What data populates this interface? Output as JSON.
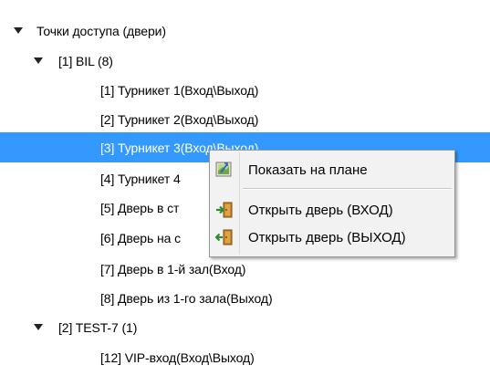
{
  "tree": {
    "root": {
      "label": "Точки доступа (двери)",
      "expanded": true
    },
    "groups": [
      {
        "label": "[1] BIL (8)",
        "expanded": true,
        "items": [
          "[1] Турникет 1(Вход\\Выход)",
          "[2] Турникет 2(Вход\\Выход)",
          "[3] Турникет 3(Вход\\Выход)",
          "[4] Турникет 4",
          "[5] Дверь в ст",
          "[6] Дверь на с",
          "[7] Дверь в 1-й зал(Вход)",
          "[8] Дверь из 1-го зала(Выход)"
        ]
      },
      {
        "label": "[2] TEST-7 (1)",
        "expanded": true,
        "items": [
          "[12] VIP-вход(Вход\\Выход)"
        ]
      }
    ],
    "selected_item": "[3] Турникет 3(Вход\\Выход)"
  },
  "context_menu": {
    "items": [
      {
        "label": "Показать на плане",
        "icon": "map-plan-icon"
      },
      {
        "label": "Открыть дверь (ВХОД)",
        "icon": "door-enter-icon"
      },
      {
        "label": "Открыть дверь (ВЫХОД)",
        "icon": "door-exit-icon"
      }
    ]
  },
  "colors": {
    "selection": "#3399ff",
    "menu_background": "#f2f2f2"
  }
}
